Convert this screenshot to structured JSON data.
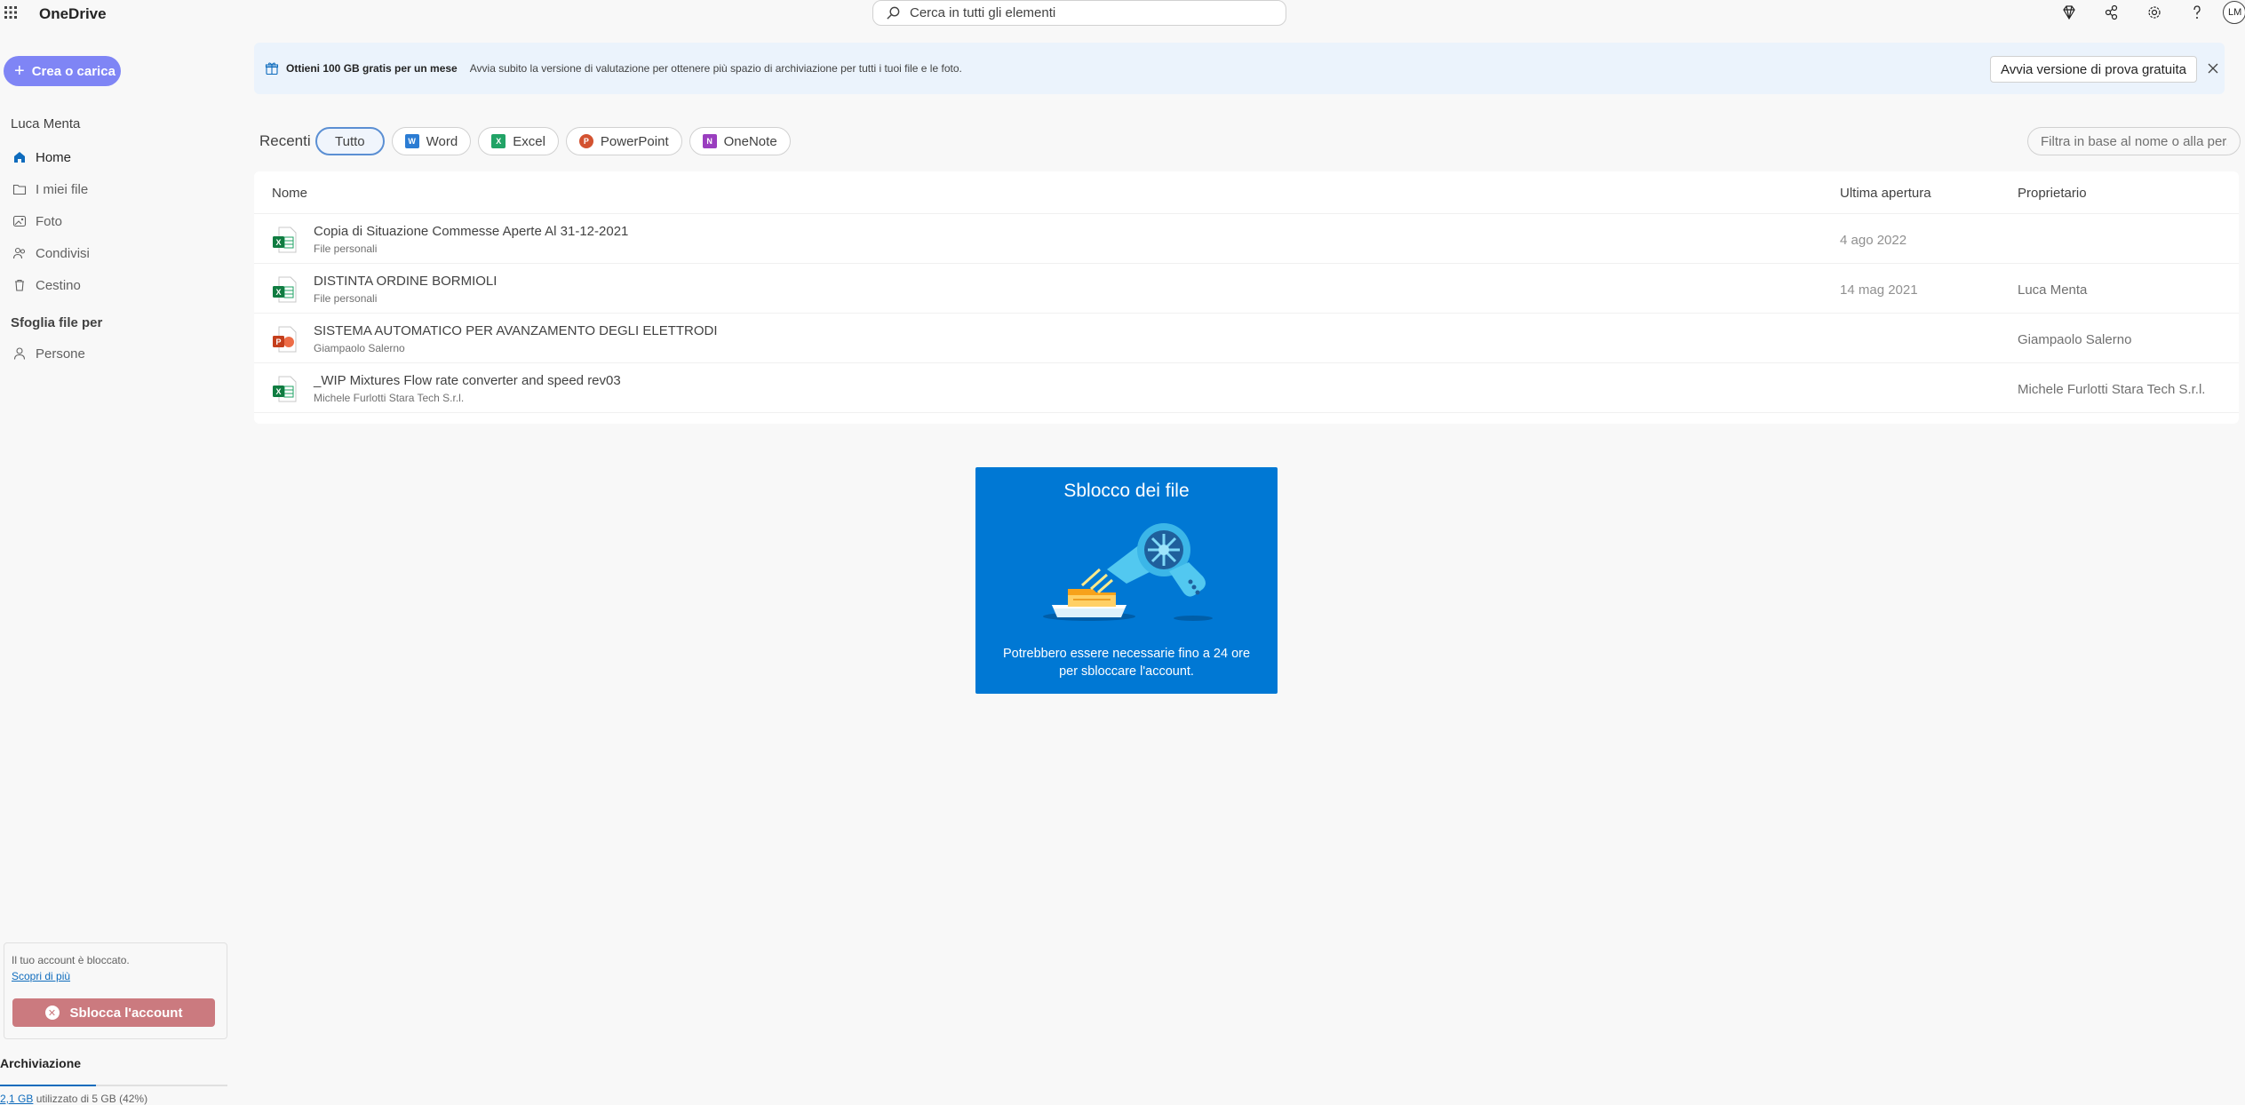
{
  "app": {
    "name": "OneDrive"
  },
  "search": {
    "placeholder": "Cerca in tutti gli elementi"
  },
  "topbar": {
    "icons": [
      "premium-diamond-icon",
      "share-network-icon",
      "settings-gear-icon",
      "help-question-icon"
    ],
    "avatar_initials": "LM"
  },
  "sidebar": {
    "create_label": "Crea o carica",
    "user_name": "Luca Menta",
    "items": [
      {
        "label": "Home",
        "icon": "home-icon"
      },
      {
        "label": "I miei file",
        "icon": "folder-icon"
      },
      {
        "label": "Foto",
        "icon": "photo-icon"
      },
      {
        "label": "Condivisi",
        "icon": "people-icon"
      },
      {
        "label": "Cestino",
        "icon": "trash-icon"
      }
    ],
    "browse_title": "Sfoglia file per",
    "browse_items": [
      {
        "label": "Persone",
        "icon": "person-icon"
      }
    ],
    "locked": {
      "message": "Il tuo account è bloccato.",
      "link": "Scopri di più",
      "button": "Sblocca l'account"
    },
    "storage": {
      "title": "Archiviazione",
      "used": "2,1 GB",
      "rest": " utilizzato di 5 GB (42%)",
      "percent": 42
    }
  },
  "banner": {
    "title": "Ottieni 100 GB gratis per un mese",
    "text": "Avvia subito la versione di valutazione per ottenere più spazio di archiviazione per tutti i tuoi file e le foto.",
    "button": "Avvia versione di prova gratuita"
  },
  "recent": {
    "label": "Recenti",
    "filters": [
      "Tutto",
      "Word",
      "Excel",
      "PowerPoint",
      "OneNote"
    ],
    "filter_placeholder": "Filtra in base al nome o alla per..."
  },
  "table": {
    "headers": {
      "name": "Nome",
      "opened": "Ultima apertura",
      "owner": "Proprietario"
    },
    "rows": [
      {
        "name": "Copia di Situazione Commesse Aperte Al 31-12-2021",
        "location": "File personali",
        "opened": "4 ago 2022",
        "owner": "",
        "type": "excel"
      },
      {
        "name": "DISTINTA ORDINE BORMIOLI",
        "location": "File personali",
        "opened": "14 mag 2021",
        "owner": "Luca Menta",
        "type": "excel"
      },
      {
        "name": "SISTEMA AUTOMATICO PER AVANZAMENTO DEGLI ELETTRODI",
        "location": "Giampaolo Salerno",
        "opened": "",
        "owner": "Giampaolo Salerno",
        "type": "powerpoint"
      },
      {
        "name": "_WIP Mixtures Flow rate converter and speed rev03",
        "location": "Michele Furlotti Stara Tech S.r.l.",
        "opened": "",
        "owner": "Michele Furlotti Stara Tech S.r.l.",
        "type": "excel"
      }
    ]
  },
  "unlock_card": {
    "title": "Sblocco dei file",
    "text": "Potrebbero essere necessarie fino a 24 ore per sbloccare l'account."
  },
  "colors": {
    "accent": "#0078d4",
    "create_button": "#7f85f5",
    "unlock_button": "#cb7a7f",
    "banner_bg": "#ebf3fc"
  }
}
